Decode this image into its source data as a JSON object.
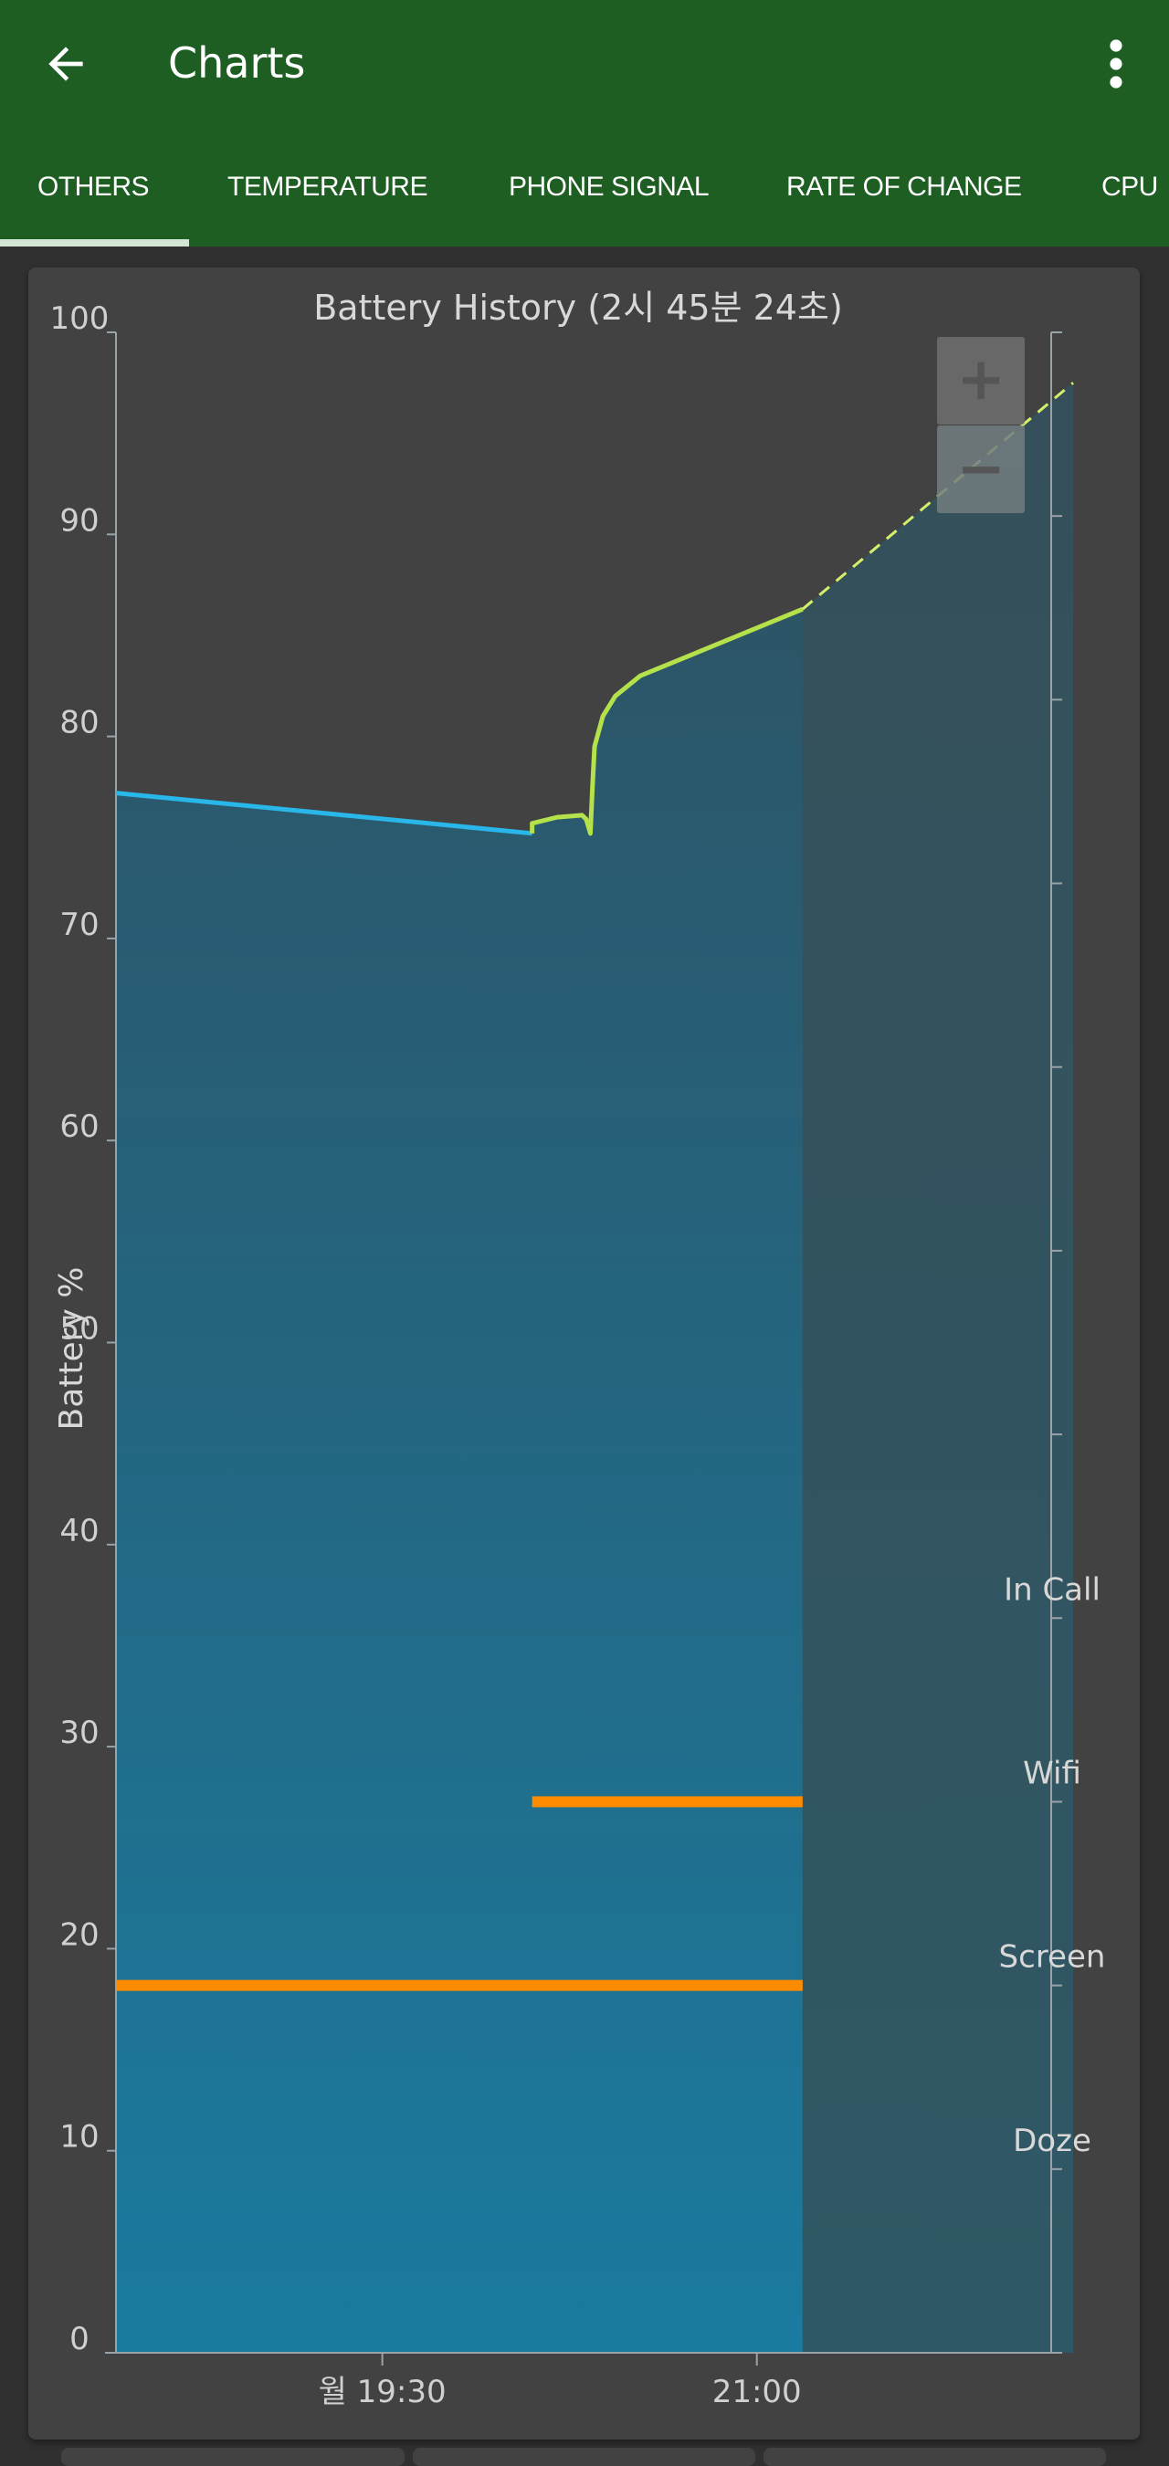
{
  "appbar": {
    "title": "Charts",
    "back_icon": "arrow-left-icon",
    "menu_icon": "more-vertical-icon"
  },
  "tabs": [
    {
      "label": "OTHERS",
      "selected": true
    },
    {
      "label": "TEMPERATURE"
    },
    {
      "label": "PHONE SIGNAL"
    },
    {
      "label": "RATE OF CHANGE"
    },
    {
      "label": "CPU"
    }
  ],
  "zoom_controls": {
    "zoom_in": "+",
    "zoom_out": "−"
  },
  "colors": {
    "appbar": "#1e5e22",
    "discharge": "#29b6e8",
    "charge": "#b5e14a",
    "state_bar": "#ff8c00"
  },
  "chart_data": {
    "type": "line",
    "title": "Battery History (2시 45분 24초)",
    "ylabel": "Battery %",
    "ylim": [
      0,
      100
    ],
    "yticks": [
      "0",
      "10",
      "20",
      "30",
      "40",
      "50",
      "60",
      "70",
      "80",
      "90",
      "100"
    ],
    "xlim": [
      "18:26",
      "22:16"
    ],
    "xticks": [
      {
        "label": "월 19:30",
        "time": "19:30"
      },
      {
        "label": "21:00",
        "time": "21:00"
      }
    ],
    "grid": false,
    "series": [
      {
        "state": "discharging",
        "color": "#29b6e8",
        "points": [
          [
            "18:26",
            77.2
          ],
          [
            "20:06",
            75.2
          ]
        ]
      },
      {
        "state": "charging",
        "color": "#b5e14a",
        "points": [
          [
            "20:06",
            75.2
          ],
          [
            "20:06",
            75.7
          ],
          [
            "20:12",
            76.0
          ],
          [
            "20:18",
            76.1
          ],
          [
            "20:19",
            75.9
          ],
          [
            "20:20",
            75.2
          ],
          [
            "20:20.5",
            77.5
          ],
          [
            "20:21",
            79.5
          ],
          [
            "20:23",
            81.0
          ],
          [
            "20:26",
            82.0
          ],
          [
            "20:32",
            83.0
          ],
          [
            "21:11",
            86.3
          ]
        ]
      },
      {
        "state": "predicted",
        "color": "#d4f06a",
        "dashed": true,
        "points": [
          [
            "21:11",
            86.3
          ],
          [
            "22:16",
            97.5
          ]
        ]
      }
    ],
    "state_tracks": [
      {
        "label": "In Call",
        "intervals": []
      },
      {
        "label": "Wifi",
        "intervals": [
          [
            "20:06",
            "21:11"
          ]
        ]
      },
      {
        "label": "Screen",
        "intervals": [
          [
            "18:26",
            "21:11"
          ]
        ]
      },
      {
        "label": "Doze",
        "intervals": []
      }
    ]
  }
}
